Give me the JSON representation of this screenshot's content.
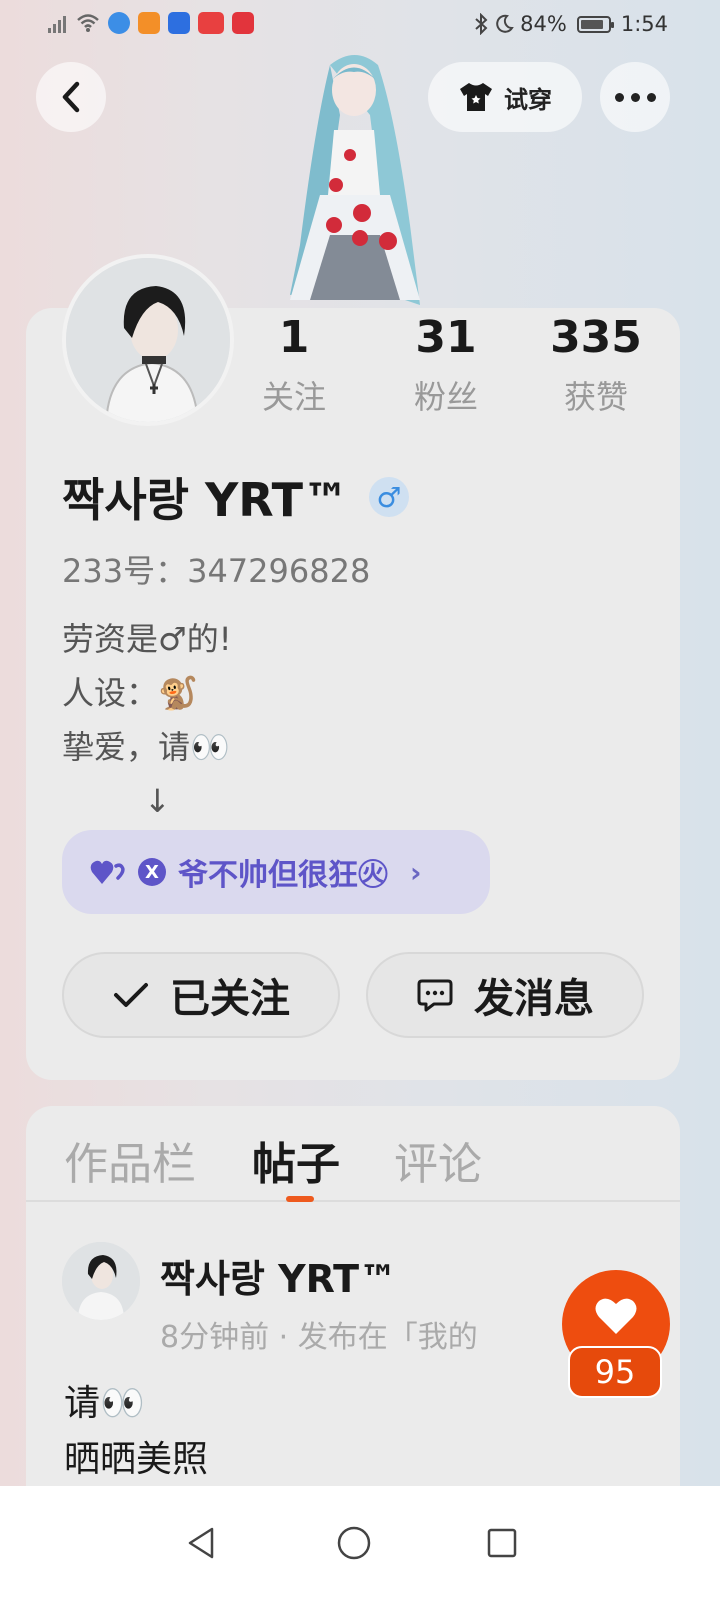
{
  "status_bar": {
    "battery": "84%",
    "time": "1:54"
  },
  "top_actions": {
    "try_on_label": "试穿"
  },
  "profile": {
    "username": "짝사랑   YRT™",
    "gender_symbol": "♂",
    "uid": "233号：347296828",
    "bio_lines": [
      "劳资是♂的!",
      "人设：🐒",
      "挚爱，请👀",
      "↓"
    ],
    "stats": [
      {
        "value": "1",
        "label": "关注"
      },
      {
        "value": "31",
        "label": "粉丝"
      },
      {
        "value": "335",
        "label": "获赞"
      }
    ],
    "club": {
      "badge": "X",
      "label": "爷不帅但很狂㊋"
    },
    "follow_label": "已关注",
    "message_label": "发消息"
  },
  "tabs": [
    {
      "label": "作品栏",
      "active": false
    },
    {
      "label": "帖子",
      "active": true
    },
    {
      "label": "评论",
      "active": false
    }
  ],
  "post": {
    "author": "짝사랑   YRT™",
    "meta": "8分钟前 · 发布在「我的",
    "text_lines": [
      "请👀",
      "晒晒美照"
    ]
  },
  "like_count": "95",
  "colors": {
    "accent": "#ee4d0f",
    "club_bg": "#dad9ee",
    "club_text": "#5e55c8",
    "gender_blue": "#3a8de0"
  }
}
